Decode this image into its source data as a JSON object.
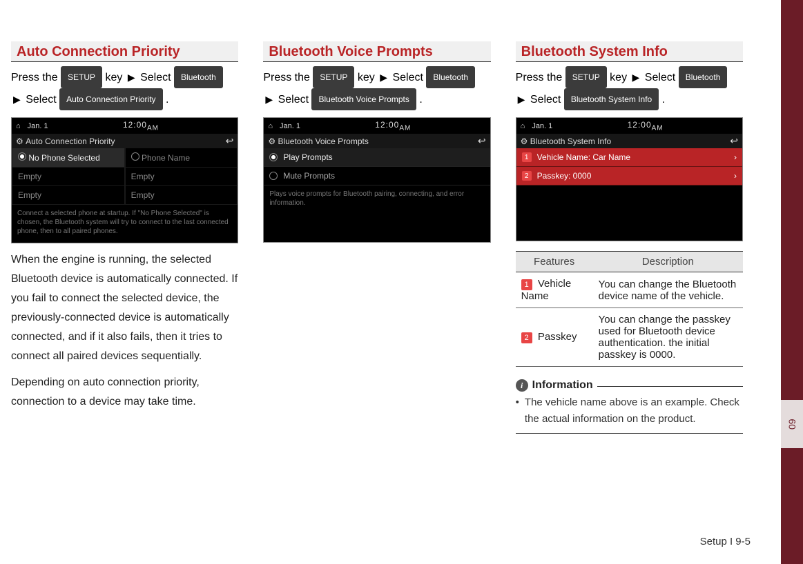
{
  "sidebar_label": "09",
  "footer": "Setup I 9-5",
  "common": {
    "press_the": "Press the",
    "key": "key",
    "select": "Select",
    "arrow": "▶",
    "setup_key": "SETUP",
    "bluetooth_key": "Bluetooth"
  },
  "col1": {
    "title": "Auto Connection Priority",
    "menu_key": "Auto Connection Priority",
    "body1": "When the engine is running, the selected Bluetooth device is automatically connected. If you fail to connect the selected device, the previously-connected device is automatically connected, and if it also fails, then it tries to connect all paired devices sequentially.",
    "body2": "Depending on auto connection priority, connection to a device may take time.",
    "shot": {
      "date": "Jan. 1",
      "time": "12:00",
      "ampm": "AM",
      "title": "Auto Connection Priority",
      "row1a": "No Phone Selected",
      "row1b": "Phone Name",
      "empty": "Empty",
      "hint": "Connect a selected phone at startup. If \"No Phone Selected\" is chosen, the Bluetooth system will try to connect to the last connected phone, then to all paired phones."
    }
  },
  "col2": {
    "title": "Bluetooth Voice Prompts",
    "menu_key": "Bluetooth Voice Prompts",
    "shot": {
      "date": "Jan. 1",
      "time": "12:00",
      "ampm": "AM",
      "title": "Bluetooth Voice Prompts",
      "opt1": "Play Prompts",
      "opt2": "Mute Prompts",
      "hint": "Plays voice prompts for Bluetooth pairing, connecting, and error information."
    }
  },
  "col3": {
    "title": "Bluetooth System Info",
    "menu_key": "Bluetooth System Info",
    "shot": {
      "date": "Jan. 1",
      "time": "12:00",
      "ampm": "AM",
      "title": "Bluetooth System Info",
      "row1": "Vehicle Name: Car Name",
      "row2": "Passkey: 0000"
    },
    "table": {
      "head_features": "Features",
      "head_desc": "Description",
      "r1_name": "Vehicle Name",
      "r1_desc": "You can change the Bluetooth device name of the vehicle.",
      "r2_name": "Passkey",
      "r2_desc": "You can change the passkey used for Bluetooth device authentication. the initial passkey is 0000."
    },
    "info_label": "Information",
    "info_bullet": "The vehicle name above is an example. Check the actual information on the product."
  }
}
